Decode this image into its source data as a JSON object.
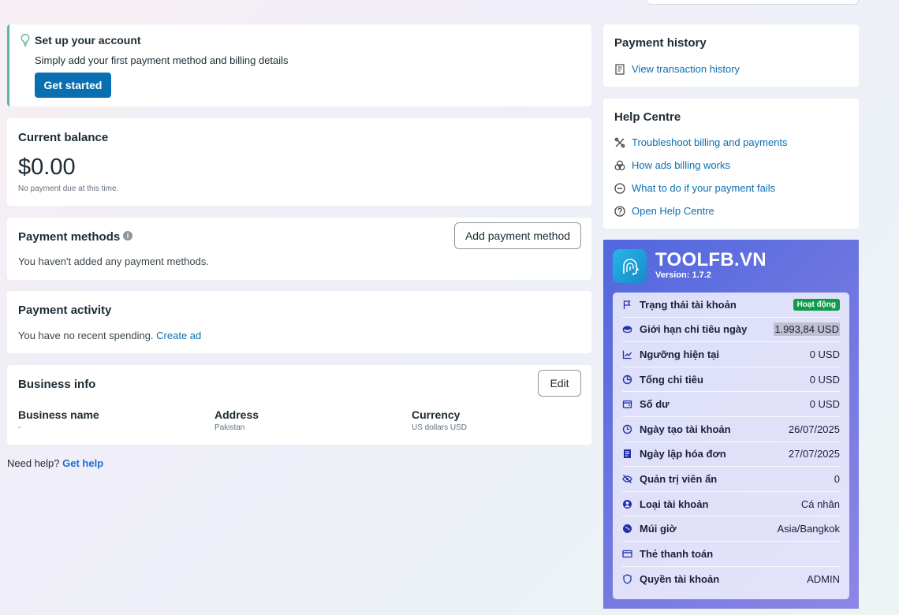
{
  "setup": {
    "title": "Set up your account",
    "subtitle": "Simply add your first payment method and billing details",
    "button": "Get started"
  },
  "balance": {
    "title": "Current balance",
    "amount": "$0.00",
    "note": "No payment due at this time."
  },
  "payment_methods": {
    "title": "Payment methods",
    "desc": "You haven't added any payment methods.",
    "button": "Add payment method"
  },
  "payment_activity": {
    "title": "Payment activity",
    "desc": "You have no recent spending.",
    "link": "Create ad"
  },
  "business_info": {
    "title": "Business info",
    "edit": "Edit",
    "columns": [
      {
        "label": "Business name",
        "value": "-"
      },
      {
        "label": "Address",
        "value": "Pakistan"
      },
      {
        "label": "Currency",
        "value": "US dollars USD"
      }
    ]
  },
  "need_help": {
    "text": "Need help?",
    "link": "Get help"
  },
  "payment_history": {
    "title": "Payment history",
    "link": "View transaction history",
    "icon": "receipt-icon"
  },
  "help_centre": {
    "title": "Help Centre",
    "links": [
      {
        "label": "Troubleshoot billing and payments",
        "icon": "tools-icon"
      },
      {
        "label": "How ads billing works",
        "icon": "coins-icon"
      },
      {
        "label": "What to do if your payment fails",
        "icon": "minus-circle-icon"
      },
      {
        "label": "Open Help Centre",
        "icon": "question-icon"
      }
    ]
  },
  "tool": {
    "brand": "TOOLFB.VN",
    "version": "Version: 1.7.2",
    "rows": [
      {
        "label": "Trạng thái tài khoản",
        "value": "Hoạt động",
        "icon": "flag-icon"
      },
      {
        "label": "Giới hạn chi tiêu ngày",
        "value": "1.993,84 USD",
        "icon": "coin-icon"
      },
      {
        "label": "Ngưỡng hiện tại",
        "value": "0 USD",
        "icon": "trend-icon"
      },
      {
        "label": "Tổng chi tiêu",
        "value": "0 USD",
        "icon": "pie-icon"
      },
      {
        "label": "Số dư",
        "value": "0 USD",
        "icon": "wallet-icon"
      },
      {
        "label": "Ngày tạo tài khoản",
        "value": "26/07/2025",
        "icon": "clock-icon"
      },
      {
        "label": "Ngày lập hóa đơn",
        "value": "27/07/2025",
        "icon": "invoice-icon"
      },
      {
        "label": "Quản trị viên ẩn",
        "value": "0",
        "icon": "eye-off-icon"
      },
      {
        "label": "Loại tài khoản",
        "value": "Cá nhân",
        "icon": "user-circle-icon"
      },
      {
        "label": "Múi giờ",
        "value": "Asia/Bangkok",
        "icon": "globe-icon"
      },
      {
        "label": "Thẻ thanh toán",
        "value": "",
        "icon": "card-icon"
      },
      {
        "label": "Quyền tài khoản",
        "value": "ADMIN",
        "icon": "shield-icon"
      }
    ]
  }
}
